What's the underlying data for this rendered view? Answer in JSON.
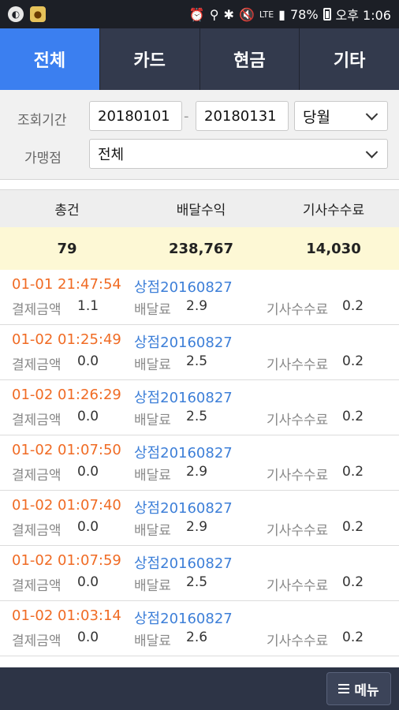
{
  "status_bar": {
    "left_icons": [
      "app-icon",
      "notification-icon"
    ],
    "right_icons": [
      "alarm-icon",
      "location-icon",
      "bluetooth-icon",
      "mute-icon",
      "wifi-icon",
      "signal-icon"
    ],
    "network": "LTE",
    "battery": "78%",
    "time": "오후 1:06"
  },
  "tabs": [
    {
      "label": "전체",
      "active": true
    },
    {
      "label": "카드",
      "active": false
    },
    {
      "label": "현금",
      "active": false
    },
    {
      "label": "기타",
      "active": false
    }
  ],
  "filters": {
    "period_label": "조회기간",
    "start_date": "20180101",
    "separator": "-",
    "end_date": "20180131",
    "period_select": "당월",
    "store_label": "가맹점",
    "store_select": "전체"
  },
  "summary": {
    "headers": [
      "총건",
      "배달수익",
      "기사수수료"
    ],
    "values": [
      "79",
      "238,767",
      "14,030"
    ]
  },
  "labels": {
    "payment": "결제금액",
    "delivery_fee": "배달료",
    "driver_fee": "기사수수료"
  },
  "transactions": [
    {
      "time": "01-01 21:47:54",
      "store": "상점20160827",
      "payment": "1.1",
      "delivery_fee": "2.9",
      "driver_fee": "0.2"
    },
    {
      "time": "01-02 01:25:49",
      "store": "상점20160827",
      "payment": "0.0",
      "delivery_fee": "2.5",
      "driver_fee": "0.2"
    },
    {
      "time": "01-02 01:26:29",
      "store": "상점20160827",
      "payment": "0.0",
      "delivery_fee": "2.5",
      "driver_fee": "0.2"
    },
    {
      "time": "01-02 01:07:50",
      "store": "상점20160827",
      "payment": "0.0",
      "delivery_fee": "2.9",
      "driver_fee": "0.2"
    },
    {
      "time": "01-02 01:07:40",
      "store": "상점20160827",
      "payment": "0.0",
      "delivery_fee": "2.9",
      "driver_fee": "0.2"
    },
    {
      "time": "01-02 01:07:59",
      "store": "상점20160827",
      "payment": "0.0",
      "delivery_fee": "2.5",
      "driver_fee": "0.2"
    },
    {
      "time": "01-02 01:03:14",
      "store": "상점20160827",
      "payment": "0.0",
      "delivery_fee": "2.6",
      "driver_fee": "0.2"
    }
  ],
  "bottom_bar": {
    "menu_label": "메뉴"
  },
  "colors": {
    "tab_active": "#3b7ff0",
    "tab_bg": "#333a4d",
    "time_text": "#f06b24",
    "store_text": "#3d7fd8",
    "summary_highlight": "#fdf8d5"
  }
}
